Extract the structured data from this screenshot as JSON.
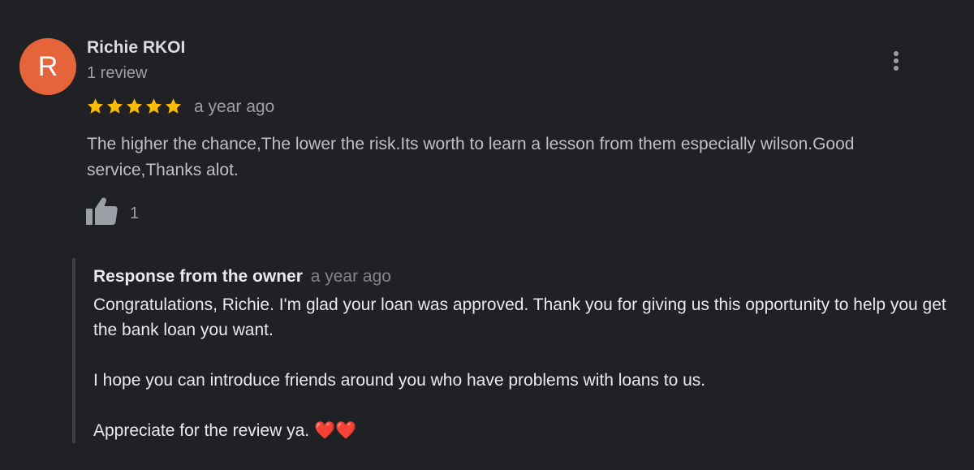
{
  "reviewer": {
    "initial": "R",
    "name": "Richie RKOI",
    "review_count": "1 review",
    "avatar_color": "#e5643a"
  },
  "rating": {
    "stars": 5,
    "max_stars": 5,
    "star_color": "#fbbc04"
  },
  "review": {
    "time_ago": "a year ago",
    "text": "The higher the chance,The lower the risk.Its worth to learn a lesson from them especially wilson.Good service,Thanks alot.",
    "likes": "1",
    "like_icon": "thumbs-up-icon",
    "menu_icon": "more-vertical-icon"
  },
  "owner_response": {
    "title": "Response from the owner",
    "time_ago": "a year ago",
    "paragraphs": [
      "Congratulations, Richie. I'm glad your loan was approved. Thank you for giving us this opportunity to help you get the bank loan you want.",
      "I hope you can introduce friends around you who have problems with loans to us.",
      "Appreciate for the review ya. ❤️❤️"
    ]
  }
}
